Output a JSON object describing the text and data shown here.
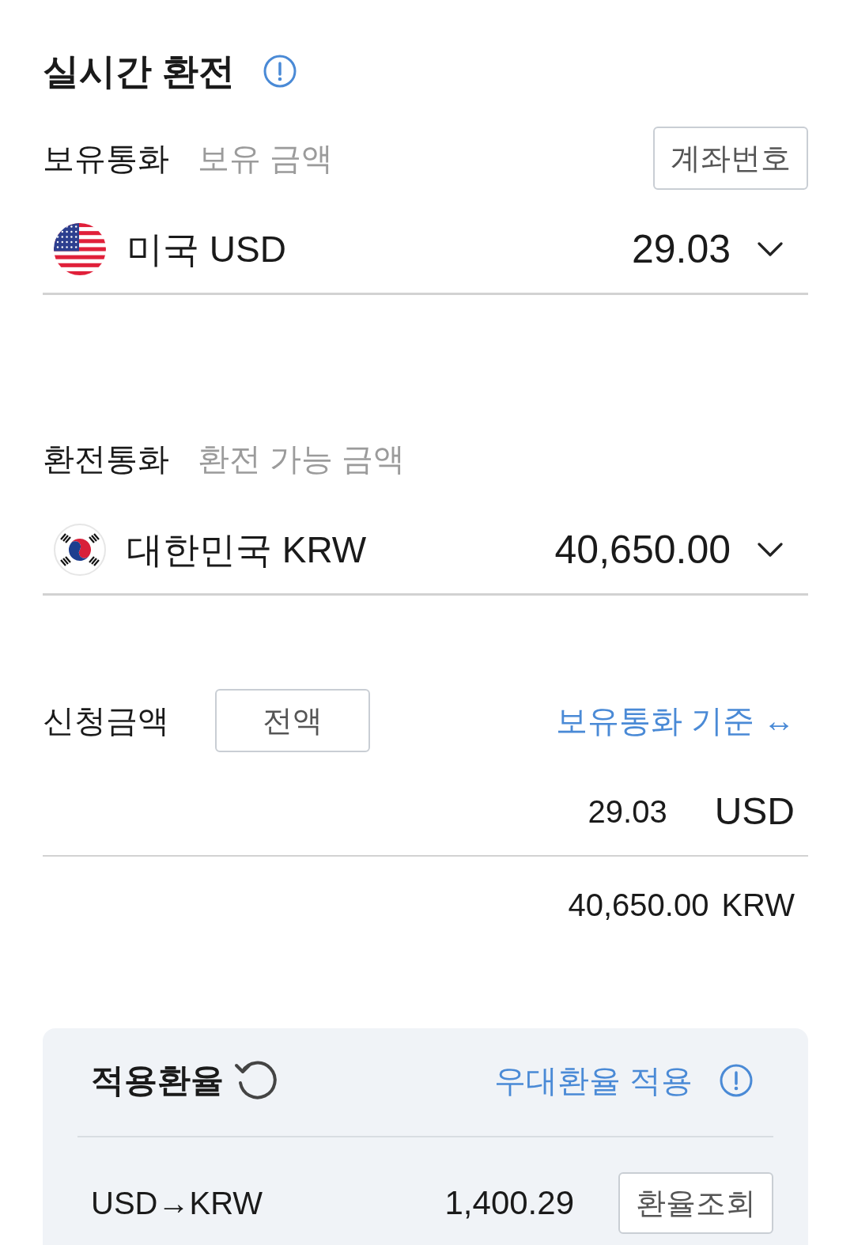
{
  "title": "실시간 환전",
  "holding": {
    "label": "보유통화",
    "hint": "보유 금액",
    "account_button": "계좌번호",
    "currency": {
      "kind": "usd",
      "name": "미국 USD",
      "amount": "29.03"
    }
  },
  "exchange": {
    "label": "환전통화",
    "hint": "환전 가능 금액",
    "currency": {
      "kind": "krw",
      "name": "대한민국 KRW",
      "amount": "40,650.00"
    }
  },
  "request": {
    "label": "신청금액",
    "full_button": "전액",
    "basis_link": "보유통화 기준 ↔",
    "amount_value": "29.03",
    "amount_unit": "USD",
    "converted_value": "40,650.00",
    "converted_unit": "KRW"
  },
  "rate_panel": {
    "title": "적용환율",
    "preferential_link": "우대환율 적용",
    "pair": "USD→KRW",
    "rate": "1,400.29",
    "lookup_button": "환율조회"
  }
}
